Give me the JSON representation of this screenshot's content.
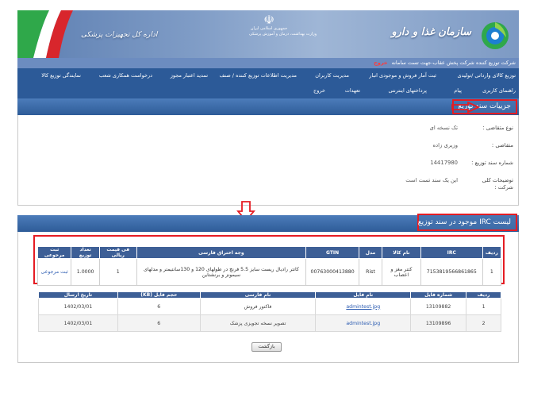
{
  "banner": {
    "org_name": "سازمان غذا و دارو",
    "sub_org": "اداره کل تجهیزات پزشکی",
    "emblem_line1": "جمهوری اسلامی ایران",
    "emblem_line2": "وزارت بهداشت، درمان و آموزش پزشکی"
  },
  "welcome": {
    "text": "شرکت توزیع کننده شرکت پخش عقاب-جهت تست سامانه",
    "logout": "خروج"
  },
  "nav": {
    "row1": [
      "توزیع کالای وارداتی /تولیدی",
      "ثبت آمار فروش و موجودی انبار",
      "مدیریت کاربران",
      "مدیریت اطلاعات توزیع کننده / صنف",
      "تمدید اعتبار مجوز",
      "درخواست همکاری شعب",
      "نمایندگی توزیع کالا"
    ],
    "row2": [
      "راهنمای کاربری",
      "پیام",
      "پرداختهای اینترنتی",
      "تعهدات",
      "خروج"
    ]
  },
  "details": {
    "section_title": "جزییات سند توزیع",
    "rows": [
      {
        "label": "نوع متقاضی :",
        "value": "تک نسخه ای"
      },
      {
        "label": "متقاضی :",
        "value": "وزیری زاده"
      },
      {
        "label": "شماره سند توزیع :",
        "value": "14417980"
      },
      {
        "label": "توضیحات کلی شرکت :",
        "value": "این یک سند تست است"
      }
    ]
  },
  "irc": {
    "section_title": "لیست IRC موجود در سند توزیع",
    "headers": [
      "ردیف",
      "IRC",
      "نام کالا",
      "مدل",
      "GTIN",
      "وجه اختراق فارسی",
      "فی قیمت ریالی",
      "تعداد توزیع",
      "ثبت مرجوعی"
    ],
    "rows": [
      [
        "1",
        "7153819566861865",
        "کتتر مغز و اعصاب",
        "Rist",
        "00763000413880",
        "کاتتر رادیال ریست سایز 5.5 فرنچ در طولهای 120 و 130سانتیمتر و مدلهای سیمونز و برنشتاین",
        "1",
        "1.0000",
        "ثبت مرجوعی"
      ]
    ]
  },
  "files": {
    "headers": [
      "ردیف",
      "شماره فایل",
      "نام فایل",
      "نام فارسی",
      "حجم فایل (KB)",
      "تاریخ ارسال"
    ],
    "rows": [
      [
        "1",
        "13109882",
        "admintest.jpg",
        "فاکتور فروش",
        "6",
        "1402/03/01"
      ],
      [
        "2",
        "13109896",
        "admintest.jpg",
        "تصویر نسخه تجویزی پزشک",
        "6",
        "1402/03/01"
      ]
    ]
  },
  "back_label": "بازگشت",
  "colors": {
    "nav_bg": "#2c5a98",
    "highlight": "#e51c23",
    "table_header": "#3d5f96"
  }
}
